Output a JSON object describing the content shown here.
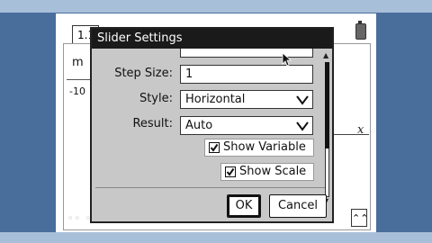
{
  "tab": {
    "label": "1.1"
  },
  "background": {
    "var_label": "m",
    "axis_min": "-10",
    "axis_label": "x"
  },
  "dialog": {
    "title": "Slider Settings",
    "step_size": {
      "label": "Step Size:",
      "value": "1"
    },
    "style": {
      "label": "Style:",
      "value": "Horizontal"
    },
    "result": {
      "label": "Result:",
      "value": "Auto"
    },
    "show_variable": {
      "label": "Show Variable",
      "checked": true
    },
    "show_scale": {
      "label": "Show Scale",
      "checked": true
    },
    "ok_label": "OK",
    "cancel_label": "Cancel"
  }
}
